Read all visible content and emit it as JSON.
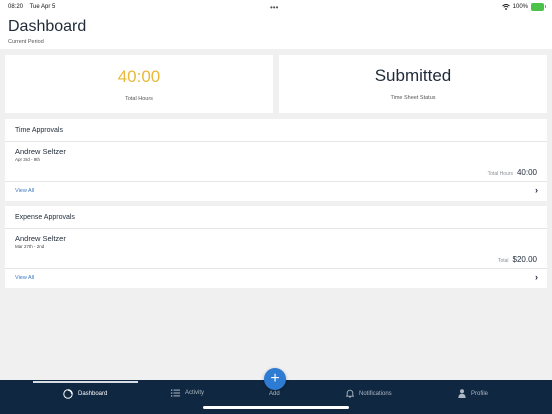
{
  "status_bar": {
    "time": "08:20",
    "date": "Tue Apr 5",
    "battery": "100%"
  },
  "header": {
    "title": "Dashboard",
    "subtitle": "Current Period"
  },
  "summary": {
    "hours": {
      "value": "40:00",
      "label": "Total Hours"
    },
    "status": {
      "value": "Submitted",
      "label": "Time Sheet Status"
    }
  },
  "time_approvals": {
    "title": "Time Approvals",
    "item": {
      "name": "Andrew Seltzer",
      "dates": "Apr 3rd - 9th",
      "amount_label": "Total Hours",
      "amount_value": "40:00"
    },
    "view_all": "View All"
  },
  "expense_approvals": {
    "title": "Expense Approvals",
    "item": {
      "name": "Andrew Seltzer",
      "dates": "Mar 27th - 2nd",
      "amount_label": "Total",
      "amount_value": "$20.00"
    },
    "view_all": "View All"
  },
  "tabs": {
    "dashboard": "Dashboard",
    "activity": "Activity",
    "add": "Add",
    "notifications": "Notifications",
    "profile": "Profile"
  },
  "colors": {
    "accent_hours": "#e8b93a",
    "tab_bar": "#0f2740",
    "fab": "#2d7bd2",
    "link": "#3a78c2"
  }
}
